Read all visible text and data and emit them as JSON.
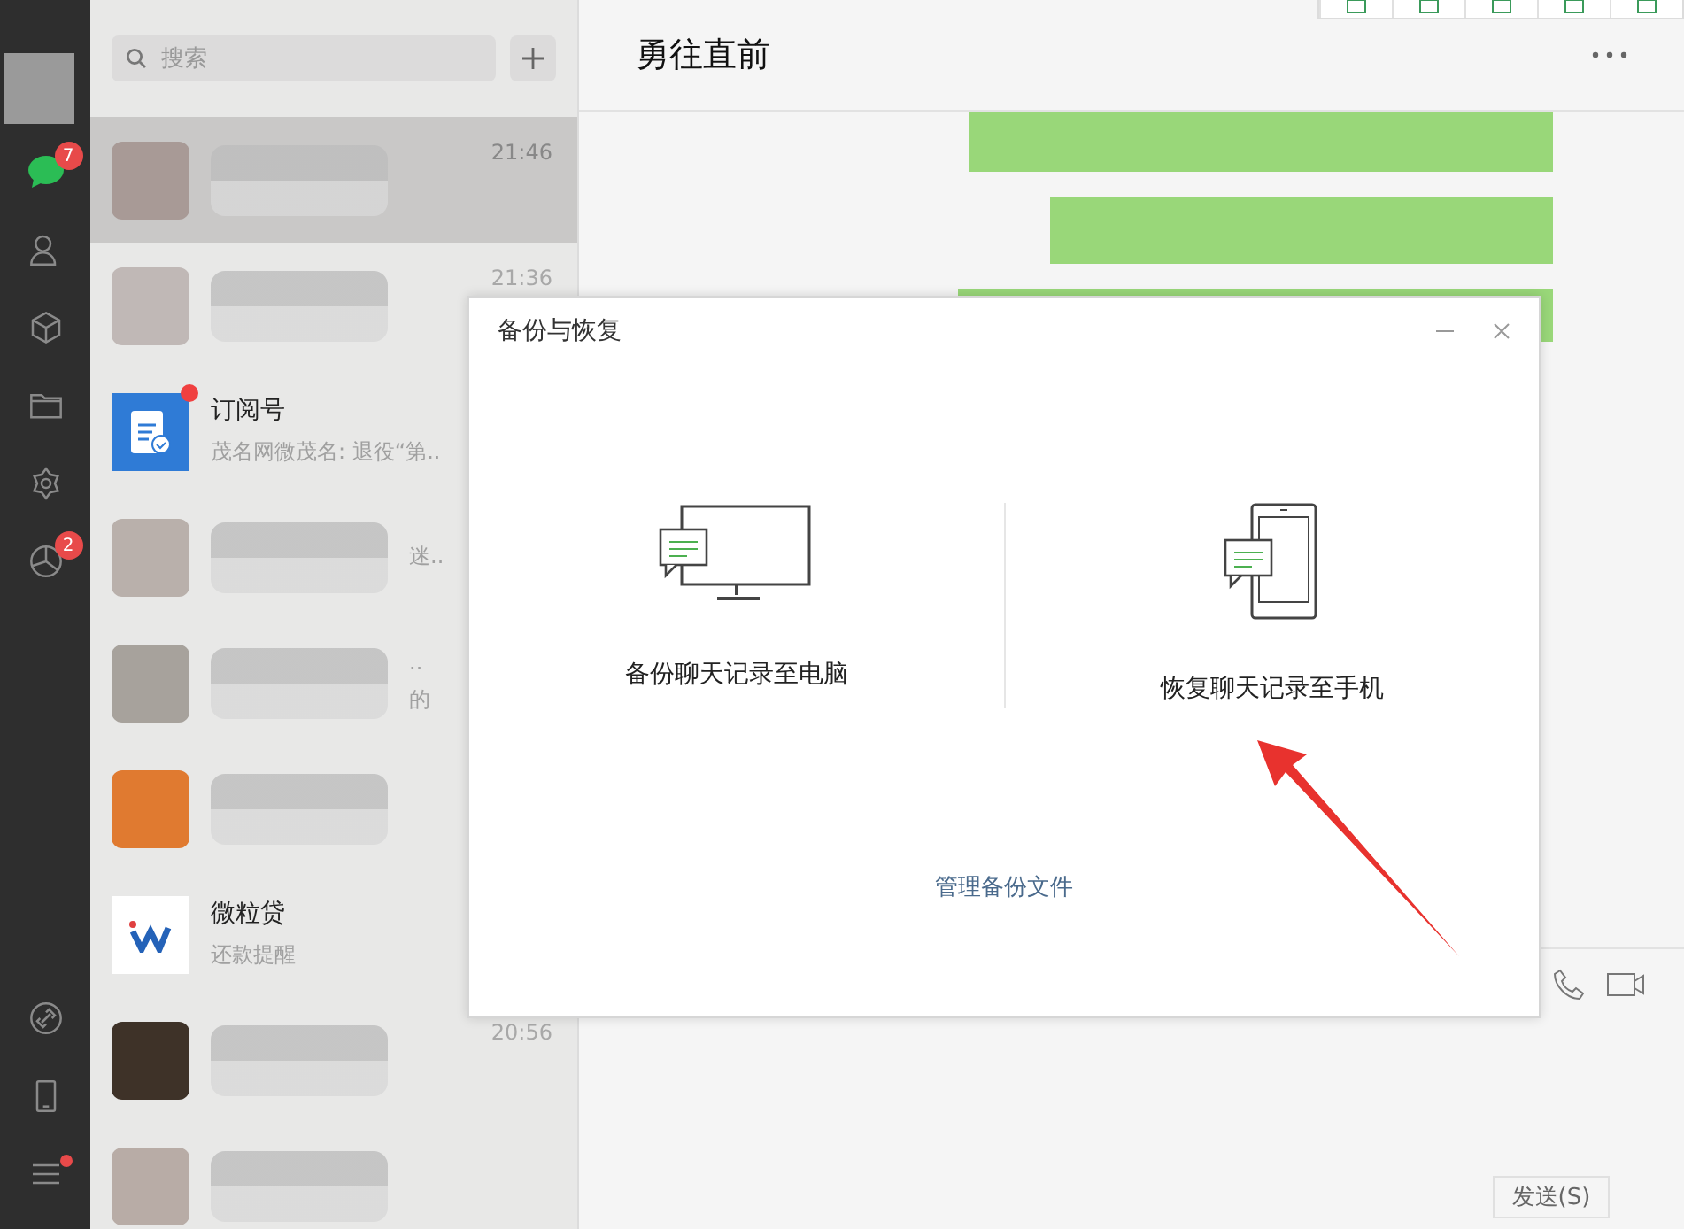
{
  "search": {
    "placeholder": "搜索"
  },
  "nav": [
    {
      "kind": "avatar"
    },
    {
      "kind": "chat",
      "selected": true,
      "badge": "7"
    },
    {
      "kind": "contacts",
      "selected": false
    },
    {
      "kind": "box",
      "selected": false
    },
    {
      "kind": "folder",
      "selected": false
    },
    {
      "kind": "gear",
      "selected": false
    },
    {
      "kind": "aperture",
      "selected": false,
      "badge": "2"
    }
  ],
  "nav_bottom": [
    {
      "kind": "link"
    },
    {
      "kind": "phone"
    },
    {
      "kind": "menu",
      "dot": true
    }
  ],
  "chats": [
    {
      "kind": "blurred",
      "selected": true,
      "time": "21:46"
    },
    {
      "kind": "blurred",
      "selected": false,
      "time": "21:36"
    },
    {
      "kind": "doc_account",
      "selected": false,
      "name": "订阅号",
      "preview": "茂名网微茂名: 退役“第..",
      "unread_dot": true
    },
    {
      "kind": "blurred",
      "selected": false,
      "tail": "迷.."
    },
    {
      "kind": "blurred",
      "selected": false,
      "tail": "..",
      "tail2": "的"
    },
    {
      "kind": "blurred",
      "selected": false
    },
    {
      "kind": "w_account",
      "selected": false,
      "name": "微粒贷",
      "preview": "还款提醒",
      "unread_dot": false
    },
    {
      "kind": "blurred",
      "selected": false,
      "time": "20:56"
    },
    {
      "kind": "blurred",
      "selected": false
    }
  ],
  "chat": {
    "title": "勇往直前",
    "send": "发送(S)"
  },
  "dialog": {
    "title": "备份与恢复",
    "options": [
      {
        "kind": "computer",
        "label": "备份聊天记录至电脑"
      },
      {
        "kind": "phone",
        "label": "恢复聊天记录至手机"
      }
    ],
    "link": "管理备份文件"
  }
}
